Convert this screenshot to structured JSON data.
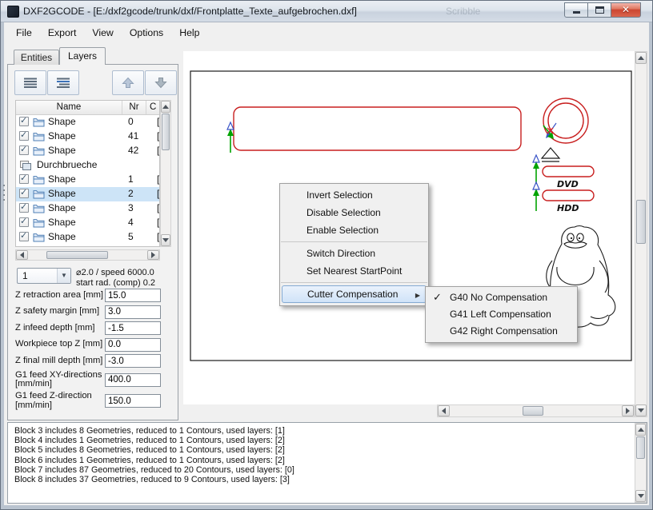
{
  "window": {
    "title": "DXF2GCODE - [E:/dxf2gcode/trunk/dxf/Frontplatte_Texte_aufgebrochen.dxf]",
    "ghost_text": "Scribble"
  },
  "menubar": {
    "items": [
      "File",
      "Export",
      "View",
      "Options",
      "Help"
    ]
  },
  "left_panel": {
    "tabs": [
      {
        "label": "Entities",
        "active": false
      },
      {
        "label": "Layers",
        "active": true
      }
    ],
    "table": {
      "columns": [
        "Name",
        "Nr",
        "C"
      ],
      "rows": [
        {
          "checked": true,
          "name": "Shape",
          "nr": "0",
          "extra": "["
        },
        {
          "checked": true,
          "name": "Shape",
          "nr": "41",
          "extra": "["
        },
        {
          "checked": true,
          "name": "Shape",
          "nr": "42",
          "extra": "["
        },
        {
          "is_layer": true,
          "name": "Durchbrueche",
          "nr": "",
          "extra": ""
        },
        {
          "checked": true,
          "name": "Shape",
          "nr": "1",
          "extra": "["
        },
        {
          "checked": true,
          "name": "Shape",
          "nr": "2",
          "extra": "[",
          "selected": true
        },
        {
          "checked": true,
          "name": "Shape",
          "nr": "3",
          "extra": "["
        },
        {
          "checked": true,
          "name": "Shape",
          "nr": "4",
          "extra": "["
        },
        {
          "checked": true,
          "name": "Shape",
          "nr": "5",
          "extra": "["
        }
      ]
    },
    "tool": {
      "selected": "1",
      "info_line1": "⌀2.0 / speed 6000.0",
      "info_line2": "start rad. (comp) 0.2"
    },
    "params": [
      {
        "label": "Z retraction area [mm]",
        "value": "15.0"
      },
      {
        "label": "Z safety margin [mm]",
        "value": "3.0"
      },
      {
        "label": "Z infeed depth [mm]",
        "value": "-1.5"
      },
      {
        "label": "Workpiece top Z [mm]",
        "value": "0.0"
      },
      {
        "label": "Z final mill depth [mm]",
        "value": "-3.0"
      },
      {
        "label": "G1 feed XY-directions [mm/min]",
        "value": "400.0"
      },
      {
        "label": "G1 feed Z-direction [mm/min]",
        "value": "150.0"
      }
    ]
  },
  "canvas": {
    "labels": [
      "DVD",
      "HDD"
    ]
  },
  "context_menu": {
    "items": [
      {
        "label": "Invert Selection"
      },
      {
        "label": "Disable Selection"
      },
      {
        "label": "Enable Selection"
      },
      {
        "separator": true
      },
      {
        "label": "Switch Direction"
      },
      {
        "label": "Set Nearest StartPoint"
      },
      {
        "separator": true
      },
      {
        "label": "Cutter Compensation",
        "submenu": true,
        "highlighted": true
      }
    ]
  },
  "submenu": {
    "items": [
      {
        "label": "G40 No Compensation",
        "checked": true
      },
      {
        "label": "G41 Left Compensation"
      },
      {
        "label": "G42 Right Compensation"
      }
    ]
  },
  "log": {
    "lines": [
      "Block 3 includes 8 Geometries, reduced to 1 Contours, used layers: [1]",
      "Block 4 includes 1 Geometries, reduced to 1 Contours, used layers: [2]",
      "Block 5 includes 8 Geometries, reduced to 1 Contours, used layers: [2]",
      "Block 6 includes 1 Geometries, reduced to 1 Contours, used layers: [2]",
      "Block 7 includes 87 Geometries, reduced to 20 Contours, used layers: [0]",
      "Block 8 includes 37 Geometries, reduced to 9 Contours, used layers: [3]"
    ]
  },
  "icons": {
    "dropdown-arrow": "▼",
    "submenu-arrow": "▶",
    "checkmark": "✓"
  },
  "colors": {
    "accent_red": "#c81e1e",
    "selection_blue": "#cde4f7",
    "marker_green": "#00a300",
    "marker_blue": "#3a54c8",
    "marker_red": "#e02020",
    "menu_highlight": "#d0e3f8",
    "menu_highlight_border": "#84aad2",
    "close_button_red": "#cc4631"
  }
}
